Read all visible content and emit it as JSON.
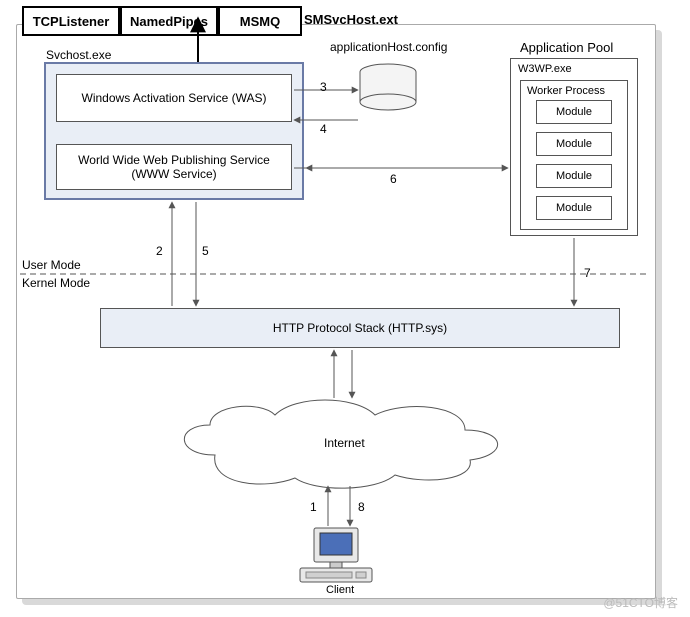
{
  "listeners": {
    "tcp": "TCPListener",
    "pipes": "NamedPipes",
    "msmq": "MSMQ"
  },
  "top": {
    "svchost_ext": "SMSvcHost.ext",
    "apphost": "applicationHost.config",
    "apppool": "Application Pool"
  },
  "svchost": {
    "title": "Svchost.exe",
    "was": "Windows Activation Service (WAS)",
    "www": "World Wide Web Publishing Service\n(WWW Service)"
  },
  "w3wp": {
    "title": "W3WP.exe",
    "worker": "Worker Process",
    "module": "Module"
  },
  "modes": {
    "user": "User Mode",
    "kernel": "Kernel Mode"
  },
  "httpsys": "HTTP Protocol Stack (HTTP.sys)",
  "internet": "Internet",
  "client": "Client",
  "nums": {
    "n1": "1",
    "n2": "2",
    "n3": "3",
    "n4": "4",
    "n5": "5",
    "n6": "6",
    "n7": "7",
    "n8": "8"
  },
  "watermark": "@51CTO博客"
}
